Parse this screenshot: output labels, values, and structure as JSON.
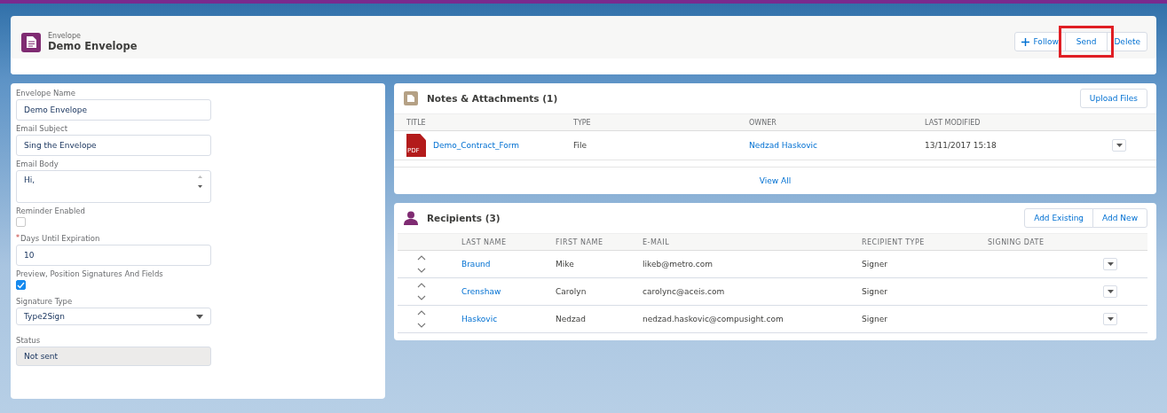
{
  "header": {
    "object_type": "Envelope",
    "title": "Demo Envelope",
    "actions": [
      {
        "kind": "add",
        "label": "Follow",
        "highlighted": false
      },
      {
        "kind": "plain",
        "label": "Send",
        "highlighted": true
      },
      {
        "kind": "plain",
        "label": "Delete",
        "highlighted": false
      }
    ]
  },
  "form": {
    "fields": [
      {
        "kind": "text",
        "label": "Envelope Name",
        "value": "Demo Envelope"
      },
      {
        "kind": "text",
        "label": "Email Subject",
        "value": "Sing the Envelope"
      },
      {
        "kind": "textarea",
        "label": "Email Body",
        "value": "Hi,"
      },
      {
        "kind": "checkbox",
        "label": "Reminder Enabled",
        "checked": false
      },
      {
        "kind": "text",
        "label": "Days Until Expiration",
        "required_mark": "*",
        "value": "10"
      },
      {
        "kind": "checkbox",
        "label": "Preview, Position Signatures And Fields",
        "checked": true
      },
      {
        "kind": "select",
        "label": "Signature Type",
        "value": "Type2Sign"
      },
      {
        "kind": "readonly",
        "label": "Status",
        "value": "Not sent"
      }
    ]
  },
  "notes": {
    "title": "Notes & Attachments (1)",
    "button": "Upload Files",
    "columns": [
      "TITLE",
      "TYPE",
      "OWNER",
      "LAST MODIFIED"
    ],
    "rows": [
      {
        "title": "Demo_Contract_Form",
        "file_badge": "PDF",
        "type": "File",
        "owner": "Nedzad Haskovic",
        "last_modified": "13/11/2017 15:18"
      }
    ],
    "footer_link": "View All"
  },
  "recipients": {
    "title": "Recipients (3)",
    "buttons": [
      "Add Existing",
      "Add New"
    ],
    "columns": [
      "LAST NAME",
      "FIRST NAME",
      "E-MAIL",
      "RECIPIENT TYPE",
      "SIGNING DATE"
    ],
    "rows": [
      {
        "last_name": "Braund",
        "first_name": "Mike",
        "email": "likeb@metro.com",
        "recipient_type": "Signer"
      },
      {
        "last_name": "Crenshaw",
        "first_name": "Carolyn",
        "email": "carolync@aceis.com",
        "recipient_type": "Signer"
      },
      {
        "last_name": "Haskovic",
        "first_name": "Nedzad",
        "email": "nedzad.haskovic@compusight.com",
        "recipient_type": "Signer"
      }
    ]
  }
}
